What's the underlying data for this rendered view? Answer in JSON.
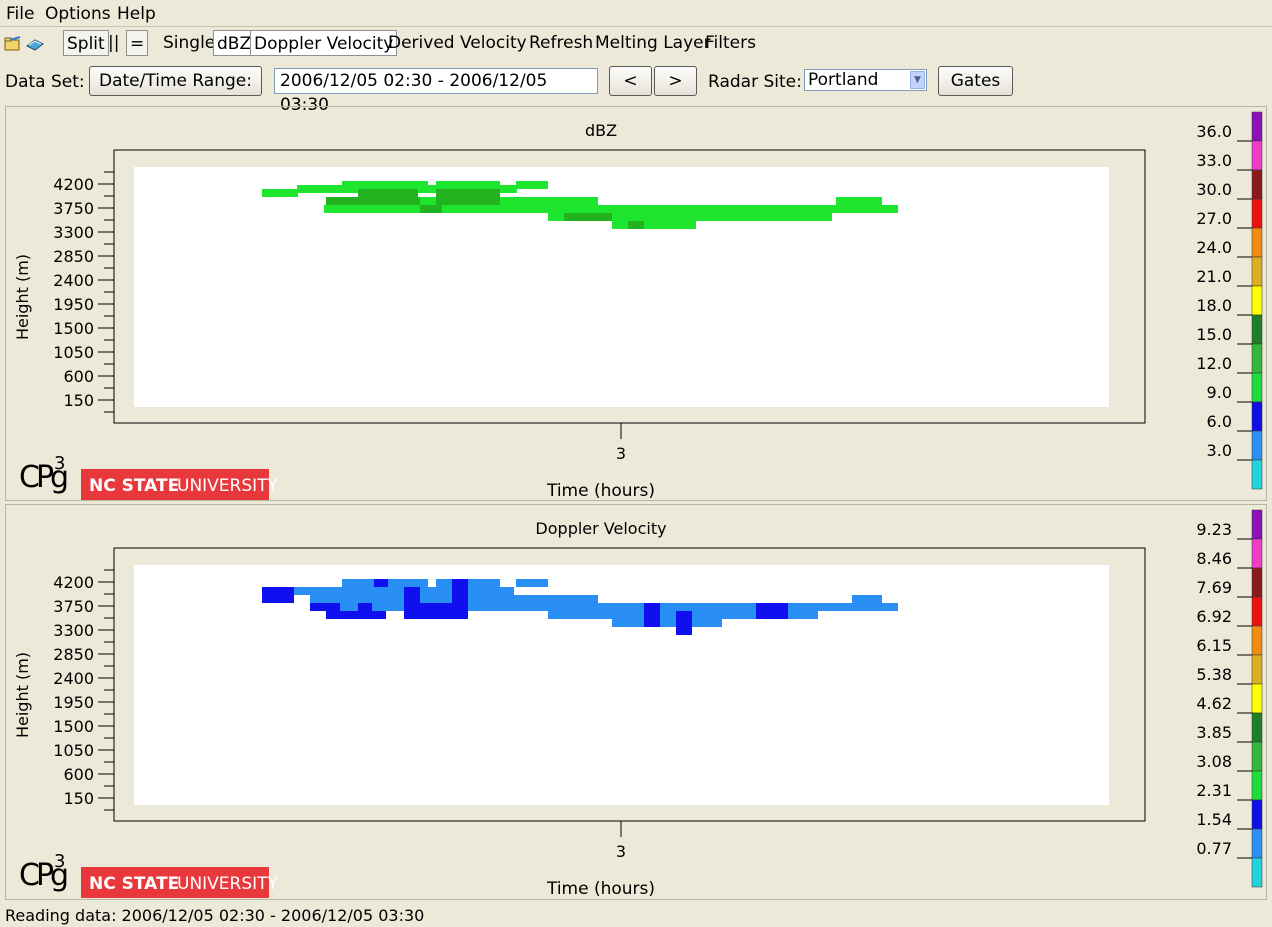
{
  "menu": {
    "file": "File",
    "options": "Options",
    "help": "Help"
  },
  "toolbar": {
    "split": "Split",
    "vertical": "||",
    "horizontal": "=",
    "single": "Single",
    "dbz": "dBZ",
    "doppler_velocity": "Doppler Velocity",
    "derived_velocity": "Derived Velocity",
    "refresh": "Refresh",
    "melting_layer": "Melting Layer",
    "filters": "Filters"
  },
  "controls": {
    "dataset_label": "Data Set:",
    "date_range_button": "Date/Time Range:",
    "date_range_value": "2006/12/05 02:30 - 2006/12/05 03:30",
    "prev": "<",
    "next": ">",
    "radar_site_label": "Radar Site:",
    "radar_site_value": "Portland",
    "gates_button": "Gates"
  },
  "logos": {
    "cpg": "CPg",
    "cpg_super": "3",
    "ncsu": "NC STATE",
    "ncsu2": "UNIVERSITY"
  },
  "colors": {
    "dbz_light": "#1ee52d",
    "dbz_dark": "#22b11f",
    "vel_light": "#2a8ff5",
    "vel_dark": "#0f0ff0",
    "ncsu_red": "#e8383c"
  },
  "chart_data": [
    {
      "type": "heatmap",
      "title": "dBZ",
      "xlabel": "Time (hours)",
      "ylabel": "Height (m)",
      "x_ticks": [
        3
      ],
      "y_ticks": [
        150,
        600,
        1050,
        1500,
        1950,
        2400,
        2850,
        3300,
        3750,
        4200
      ],
      "colorbar": {
        "labels": [
          "36.0",
          "33.0",
          "30.0",
          "27.0",
          "24.0",
          "21.0",
          "18.0",
          "15.0",
          "12.0",
          "9.0",
          "6.0",
          "3.0"
        ],
        "colors": [
          "#8a12b8",
          "#f03cc8",
          "#8b1b1b",
          "#ee1111",
          "#ee8c14",
          "#d9b020",
          "#ffff00",
          "#1f7f28",
          "#35b73e",
          "#1cdd3a",
          "#0f10e8",
          "#2b8ff4",
          "#22d3dc"
        ]
      },
      "cells_light": [
        [
          8,
          2,
          1,
          1
        ],
        [
          13,
          2,
          3,
          1
        ],
        [
          12,
          1,
          1,
          1
        ],
        [
          9,
          1,
          4,
          1
        ],
        [
          9,
          1,
          2,
          1
        ],
        [
          14,
          -1,
          1,
          1
        ],
        [
          15,
          -1,
          4,
          1
        ],
        [
          13,
          3,
          1,
          1
        ],
        [
          17,
          3,
          1,
          1
        ],
        [
          20,
          -2,
          3,
          1
        ],
        [
          19,
          -2,
          2,
          1
        ]
      ],
      "cells_dark": []
    },
    {
      "type": "heatmap",
      "title": "Doppler Velocity",
      "xlabel": "Time (hours)",
      "ylabel": "Height (m)",
      "x_ticks": [
        3
      ],
      "y_ticks": [
        150,
        600,
        1050,
        1500,
        1950,
        2400,
        2850,
        3300,
        3750,
        4200
      ],
      "colorbar": {
        "labels": [
          "9.23",
          "8.46",
          "7.69",
          "6.92",
          "6.15",
          "5.38",
          "4.62",
          "3.85",
          "3.08",
          "2.31",
          "1.54",
          "0.77"
        ],
        "colors": [
          "#8a12b8",
          "#f03cc8",
          "#8b1b1b",
          "#ee1111",
          "#ee8c14",
          "#d9b020",
          "#ffff00",
          "#1f7f28",
          "#35b73e",
          "#1cdd3a",
          "#0f10e8",
          "#2b8ff4",
          "#22d3dc"
        ]
      }
    }
  ]
}
